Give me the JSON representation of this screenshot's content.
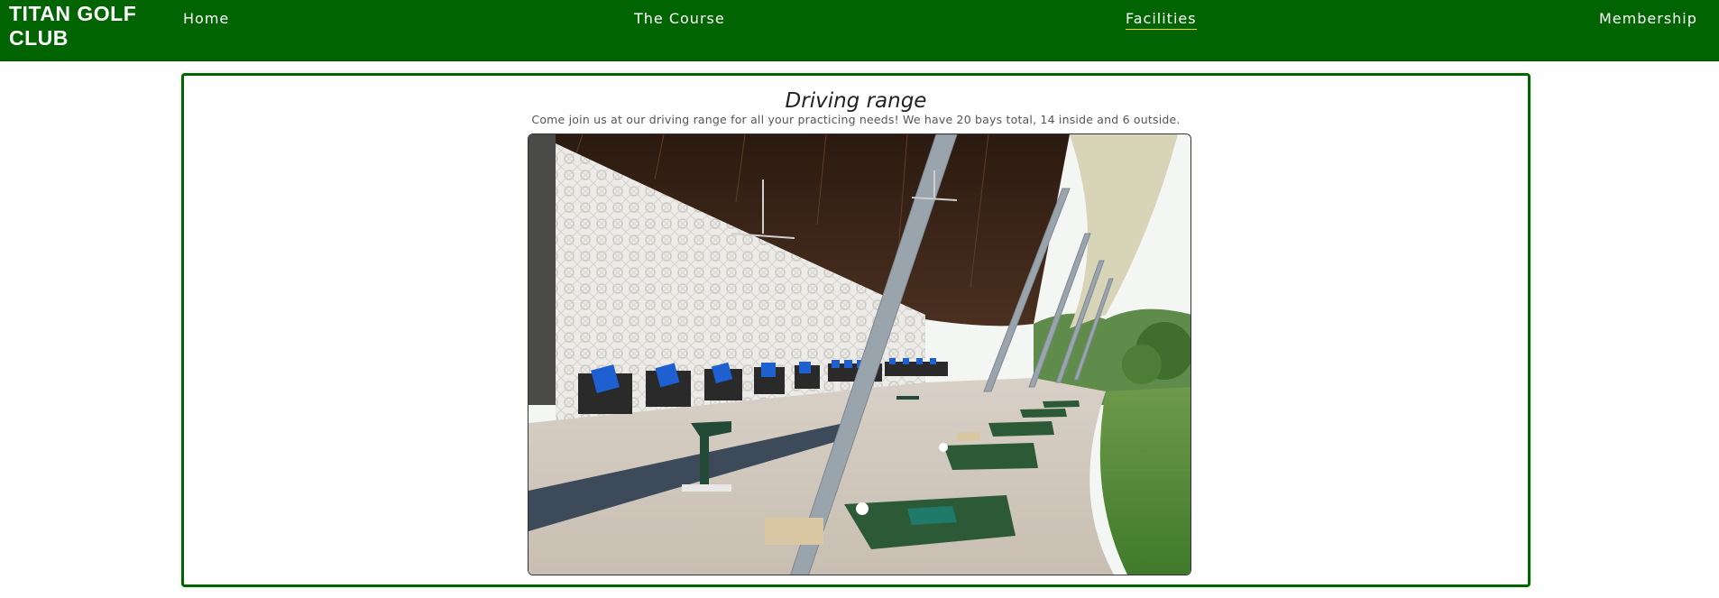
{
  "brand": {
    "name": "TITAN GOLF CLUB"
  },
  "nav": {
    "items": [
      {
        "label": "Home",
        "active": false
      },
      {
        "label": "The Course",
        "active": false
      },
      {
        "label": "Facilities",
        "active": true
      },
      {
        "label": "Membership",
        "active": false
      }
    ]
  },
  "facility": {
    "title": "Driving range",
    "description": "Come join us at our driving range for all your practicing needs! We have 20 bays total, 14 inside and 6 outside."
  },
  "colors": {
    "nav_background": "#006400",
    "card_border": "#006400",
    "active_underline": "#ffd700"
  }
}
